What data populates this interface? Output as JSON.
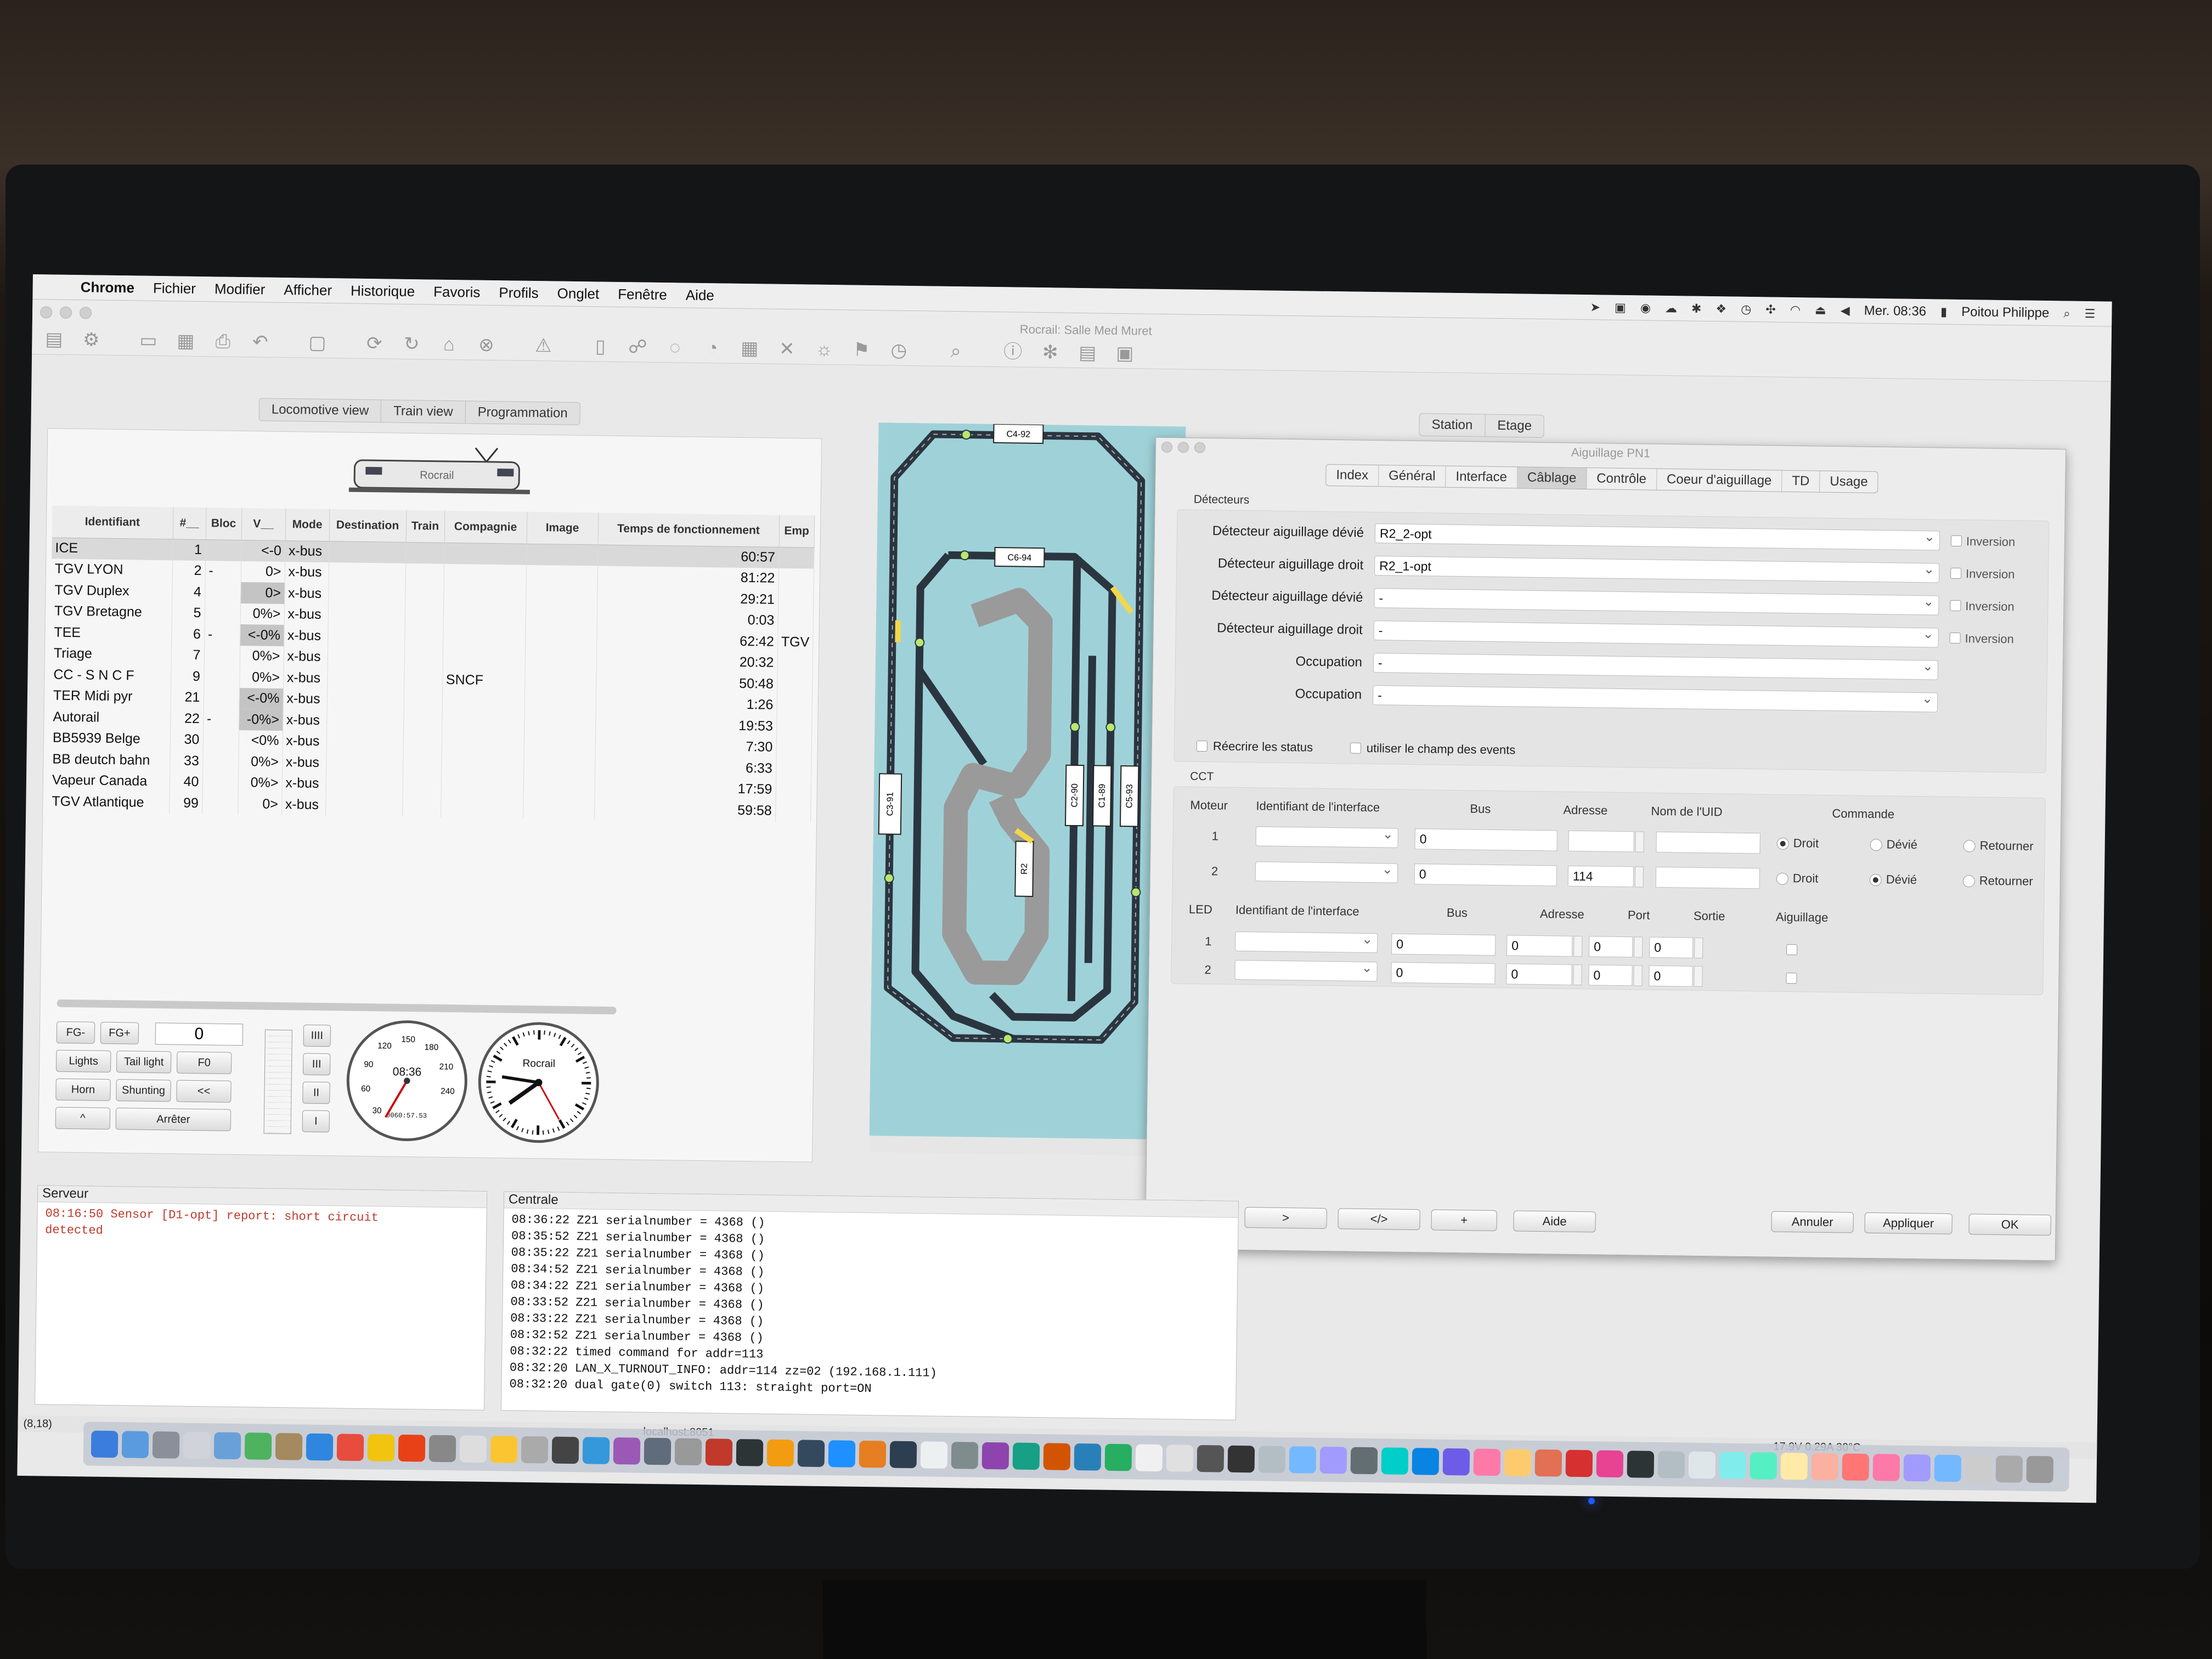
{
  "menubar": {
    "app": "Chrome",
    "items": [
      "Fichier",
      "Modifier",
      "Afficher",
      "Historique",
      "Favoris",
      "Profils",
      "Onglet",
      "Fenêtre",
      "Aide"
    ],
    "clock": "Mer. 08:36",
    "user": "Poitou Philippe"
  },
  "window": {
    "title": "Rocrail: Salle Med Muret"
  },
  "left_tabs": [
    "Locomotive view",
    "Train view",
    "Programmation"
  ],
  "loco_table": {
    "headers": [
      "Identifiant",
      "#__",
      "Bloc",
      "V__",
      "Mode",
      "Destination",
      "Train",
      "Compagnie",
      "Image",
      "Temps de fonctionnement",
      "Emp"
    ],
    "rows": [
      {
        "id": "ICE",
        "num": "1",
        "bloc": "",
        "v": "<-0",
        "mode": "x-bus",
        "comp": "",
        "time": "60:57",
        "emp": ""
      },
      {
        "id": "TGV LYON",
        "num": "2",
        "bloc": "-",
        "v": "0>",
        "mode": "x-bus",
        "comp": "",
        "time": "81:22",
        "emp": ""
      },
      {
        "id": "TGV Duplex",
        "num": "4",
        "bloc": "",
        "v": "0>",
        "mode": "x-bus",
        "comp": "",
        "time": "29:21",
        "emp": ""
      },
      {
        "id": "TGV Bretagne",
        "num": "5",
        "bloc": "",
        "v": "0%>",
        "mode": "x-bus",
        "comp": "",
        "time": "0:03",
        "emp": ""
      },
      {
        "id": "TEE",
        "num": "6",
        "bloc": "-",
        "v": "<-0%",
        "mode": "x-bus",
        "comp": "",
        "time": "62:42",
        "emp": "TGV"
      },
      {
        "id": "Triage",
        "num": "7",
        "bloc": "",
        "v": "0%>",
        "mode": "x-bus",
        "comp": "",
        "time": "20:32",
        "emp": ""
      },
      {
        "id": "CC - S N C F",
        "num": "9",
        "bloc": "",
        "v": "0%>",
        "mode": "x-bus",
        "comp": "SNCF",
        "time": "50:48",
        "emp": ""
      },
      {
        "id": "TER Midi pyr",
        "num": "21",
        "bloc": "",
        "v": "<-0%",
        "mode": "x-bus",
        "comp": "",
        "time": "1:26",
        "emp": ""
      },
      {
        "id": "Autorail",
        "num": "22",
        "bloc": "-",
        "v": "-0%>",
        "mode": "x-bus",
        "comp": "",
        "time": "19:53",
        "emp": ""
      },
      {
        "id": "BB5939 Belge",
        "num": "30",
        "bloc": "",
        "v": "<0%",
        "mode": "x-bus",
        "comp": "",
        "time": "7:30",
        "emp": ""
      },
      {
        "id": "BB deutch bahn",
        "num": "33",
        "bloc": "",
        "v": "0%>",
        "mode": "x-bus",
        "comp": "",
        "time": "6:33",
        "emp": ""
      },
      {
        "id": "Vapeur Canada",
        "num": "40",
        "bloc": "",
        "v": "0%>",
        "mode": "x-bus",
        "comp": "",
        "time": "17:59",
        "emp": ""
      },
      {
        "id": "TGV Atlantique",
        "num": "99",
        "bloc": "",
        "v": "0>",
        "mode": "x-bus",
        "comp": "",
        "time": "59:58",
        "emp": ""
      }
    ]
  },
  "loco_img_text": "Rocrail",
  "controls": {
    "fg_minus": "FG-",
    "fg_plus": "FG+",
    "speed": "0",
    "lights": "Lights",
    "tail": "Tail light",
    "f0": "F0",
    "horn": "Horn",
    "shunting": "Shunting",
    "back": "<<",
    "up": "^",
    "stop": "Arrêter",
    "gears": [
      "IIII",
      "III",
      "II",
      "I"
    ],
    "speedo_time": "08:36",
    "speedo_odo": "0060:57.53",
    "speedo_ticks": [
      "30",
      "60",
      "90",
      "120",
      "150",
      "180",
      "210",
      "240"
    ],
    "clock_brand": "Rocrail"
  },
  "right_tabs": [
    "Station",
    "Etage"
  ],
  "track_blocks": [
    "C4-92",
    "C6-94",
    "C3-91",
    "C2-90",
    "C1-89",
    "C5-93",
    "R2"
  ],
  "dialog": {
    "title": "Aiguillage PN1",
    "tabs": [
      "Index",
      "Général",
      "Interface",
      "Câblage",
      "Contrôle",
      "Coeur d'aiguillage",
      "TD",
      "Usage"
    ],
    "active_tab": "Câblage",
    "detecteurs_label": "Détecteurs",
    "det_rows": [
      {
        "label": "Détecteur aiguillage dévié",
        "value": "R2_2-opt",
        "inv": "Inversion"
      },
      {
        "label": "Détecteur aiguillage droit",
        "value": "R2_1-opt",
        "inv": "Inversion"
      },
      {
        "label": "Détecteur aiguillage dévié",
        "value": "-",
        "inv": "Inversion"
      },
      {
        "label": "Détecteur aiguillage droit",
        "value": "-",
        "inv": "Inversion"
      },
      {
        "label": "Occupation",
        "value": "-",
        "inv": ""
      },
      {
        "label": "Occupation",
        "value": "-",
        "inv": ""
      }
    ],
    "rewrite_status": "Réecrire les status",
    "use_events": "utiliser le champ des events",
    "cct_label": "CCT",
    "cct_headers": [
      "Moteur",
      "Identifiant de l'interface",
      "Bus",
      "Adresse",
      "Nom de l'UID",
      "Commande"
    ],
    "cct_rows": [
      {
        "n": "1",
        "bus": "0",
        "addr": "",
        "uid": "",
        "sel": "Droit"
      },
      {
        "n": "2",
        "bus": "0",
        "addr": "114",
        "uid": "",
        "sel": "Dévié"
      }
    ],
    "cmd_opts": [
      "Droit",
      "Dévié",
      "Retourner"
    ],
    "led_headers": [
      "LED",
      "Identifiant de l'interface",
      "Bus",
      "Adresse",
      "Port",
      "Sortie",
      "Aiguillage"
    ],
    "led_rows": [
      {
        "n": "1",
        "bus": "0",
        "addr": "0",
        "port": "0",
        "out": "0"
      },
      {
        "n": "2",
        "bus": "0",
        "addr": "0",
        "port": "0",
        "out": "0"
      }
    ],
    "nav_buttons": [
      "<",
      ">",
      "</>",
      "+"
    ],
    "help": "Aide",
    "cancel": "Annuler",
    "apply": "Appliquer",
    "ok": "OK"
  },
  "serveur": {
    "title": "Serveur",
    "lines": [
      "08:16:50 Sensor [D1-opt] report: short circuit",
      "detected"
    ]
  },
  "centrale": {
    "title": "Centrale",
    "lines": [
      "08:36:22 Z21 serialnumber = 4368 ()",
      "08:35:52 Z21 serialnumber = 4368 ()",
      "08:35:22 Z21 serialnumber = 4368 ()",
      "08:34:52 Z21 serialnumber = 4368 ()",
      "08:34:22 Z21 serialnumber = 4368 ()",
      "08:33:52 Z21 serialnumber = 4368 ()",
      "08:33:22 Z21 serialnumber = 4368 ()",
      "08:32:52 Z21 serialnumber = 4368 ()",
      "08:32:22 timed command for addr=113",
      "08:32:20 LAN_X_TURNOUT_INFO: addr=114 zz=02 (192.168.1.111)",
      "08:32:20 dual gate(0) switch 113: straight port=ON"
    ]
  },
  "status": {
    "coords": "(8,18)",
    "host": "localhost:8051",
    "power": "17.9V 0.29A 30°C"
  },
  "colors": {
    "track_bg": "#9fd2d8",
    "block_yellow": "#f2d64c"
  }
}
